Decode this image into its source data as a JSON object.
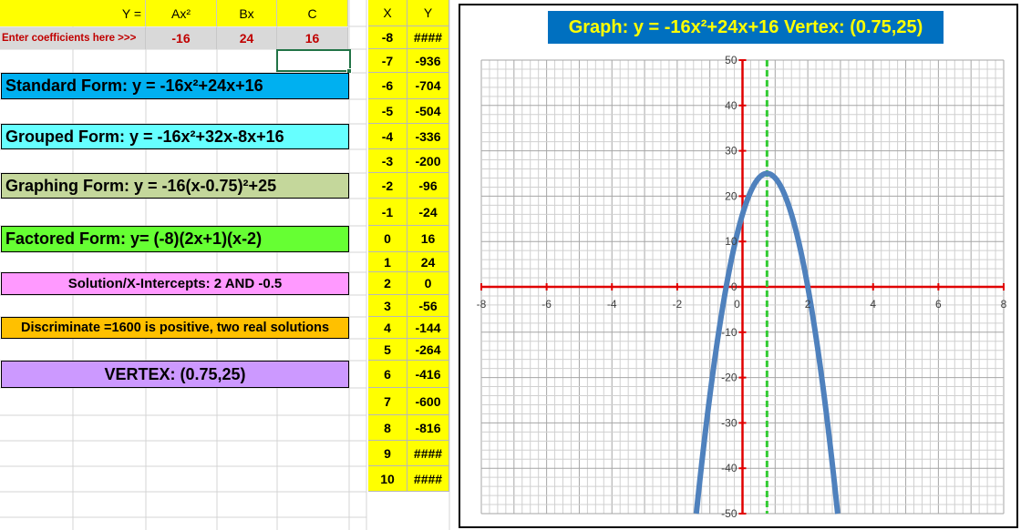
{
  "coefficients": {
    "y_label": "Y =",
    "a_label": "Ax²",
    "b_label": "Bx",
    "c_label": "C",
    "prompt": "Enter coefficients here >>>",
    "a": "-16",
    "b": "24",
    "c": "16"
  },
  "forms": {
    "standard": "Standard Form: y = -16x²+24x+16",
    "grouped": "Grouped  Form: y = -16x²+32x-8x+16",
    "graphing": "Graphing Form: y = -16(x-0.75)²+25",
    "factored": "Factored Form:  y= (-8)(2x+1)(x-2)",
    "solutions": "Solution/X-Intercepts: 2 AND -0.5",
    "discriminant": "Discriminate =1600 is positive, two real solutions",
    "vertex": "VERTEX: (0.75,25)"
  },
  "colors": {
    "standard": "#00b0f0",
    "grouped": "#66ffff",
    "graphing": "#c4d79b",
    "factored": "#66ff33",
    "solutions": "#ff99ff",
    "discriminant": "#ffc000",
    "vertex": "#cc99ff",
    "table": "#ffff00",
    "curve": "#4f81bd",
    "axes": "#e00000",
    "vertex_line": "#33cc33",
    "title_bg": "#0070c0",
    "title_text": "#ffff00"
  },
  "table": {
    "x_header": "X",
    "y_header": "Y",
    "rows": [
      {
        "x": "-8",
        "y": "####"
      },
      {
        "x": "-7",
        "y": "-936"
      },
      {
        "x": "-6",
        "y": "-704"
      },
      {
        "x": "-5",
        "y": "-504"
      },
      {
        "x": "-4",
        "y": "-336"
      },
      {
        "x": "-3",
        "y": "-200"
      },
      {
        "x": "-2",
        "y": "-96"
      },
      {
        "x": "-1",
        "y": "-24"
      },
      {
        "x": "0",
        "y": "16"
      },
      {
        "x": "1",
        "y": "24"
      },
      {
        "x": "2",
        "y": "0"
      },
      {
        "x": "3",
        "y": "-56"
      },
      {
        "x": "4",
        "y": "-144"
      },
      {
        "x": "5",
        "y": "-264"
      },
      {
        "x": "6",
        "y": "-416"
      },
      {
        "x": "7",
        "y": "-600"
      },
      {
        "x": "8",
        "y": "-816"
      },
      {
        "x": "9",
        "y": "####"
      },
      {
        "x": "10",
        "y": "####"
      }
    ]
  },
  "chart_data": {
    "type": "line",
    "title": "Graph: y = -16x²+24x+16  Vertex: (0.75,25)",
    "xlim": [
      -8,
      8
    ],
    "ylim": [
      -50,
      50
    ],
    "x_ticks": [
      "-8",
      "-6",
      "-4",
      "-2",
      "0",
      "2",
      "4",
      "6",
      "8"
    ],
    "y_ticks": [
      "50",
      "40",
      "30",
      "20",
      "10",
      "0",
      "-10",
      "-20",
      "-30",
      "-40",
      "-50"
    ],
    "minor_grid": true,
    "coefficients": {
      "a": -16,
      "b": 24,
      "c": 16
    },
    "vertex_x": 0.75,
    "vertex_y": 25
  }
}
